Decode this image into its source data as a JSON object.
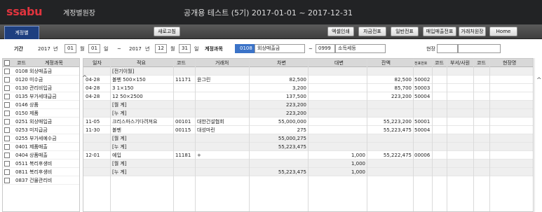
{
  "header": {
    "logo": "ssabu",
    "app_title": "계정별원장",
    "company": "공개용 테스트 (5기) 2017-01-01 ~ 2017-12-31"
  },
  "toolbar": {
    "tab": "계정별",
    "refresh": "새로고침",
    "buttons": [
      "엑셀인쇄",
      "자금전표",
      "일반전표",
      "매입매출전표",
      "거래처원장",
      "Home"
    ]
  },
  "filter": {
    "period_label": "기간",
    "start_year": "2017",
    "year_unit": "년",
    "start_month": "01",
    "month_unit": "월",
    "start_day": "01",
    "day_unit": "일",
    "tilde": "~",
    "end_year": "2017",
    "end_month": "12",
    "end_day": "31",
    "account_label": "계정과목",
    "from_code": "0108",
    "from_name": "외상매출금",
    "to_code": "0999",
    "to_name": "소득세등",
    "site_label": "현장",
    "site_code": "",
    "site_name": ""
  },
  "accounts": {
    "header": {
      "code": "코드",
      "name": "계정과목"
    },
    "items": [
      {
        "code": "0108",
        "name": "외상매출금"
      },
      {
        "code": "0120",
        "name": "미수금"
      },
      {
        "code": "0130",
        "name": "관리비입금"
      },
      {
        "code": "0135",
        "name": "부가세대급금"
      },
      {
        "code": "0146",
        "name": "상품"
      },
      {
        "code": "0150",
        "name": "제품"
      },
      {
        "code": "0251",
        "name": "외상매입금"
      },
      {
        "code": "0253",
        "name": "미지급금"
      },
      {
        "code": "0255",
        "name": "부가세예수금"
      },
      {
        "code": "0401",
        "name": "제품매출"
      },
      {
        "code": "0404",
        "name": "상품매출"
      },
      {
        "code": "0511",
        "name": "복리후생비"
      },
      {
        "code": "0811",
        "name": "복리후생비"
      },
      {
        "code": "0837",
        "name": "건물관리비"
      }
    ]
  },
  "ledger": {
    "columns": {
      "date": "일자",
      "desc": "적요",
      "code": "코드",
      "partner": "거래처",
      "debit": "차변",
      "credit": "대변",
      "balance": "잔액",
      "voucher": "전표번호",
      "code2": "코드",
      "dept": "부서/사원",
      "code3": "코드",
      "site": "현장명"
    },
    "rows": [
      {
        "date": "",
        "desc": "[전기이월]",
        "code": "",
        "partner": "",
        "debit": "",
        "credit": "",
        "balance": "",
        "voucher": "",
        "sub": true
      },
      {
        "date": "04-28",
        "desc": "볼펜 500×150",
        "code": "11171",
        "partner": "윤그린",
        "debit": "82,500",
        "credit": "",
        "balance": "82,500",
        "voucher": "50002",
        "sub": false
      },
      {
        "date": "04-28",
        "desc": "3 1×150",
        "code": "",
        "partner": "",
        "debit": "3,200",
        "credit": "",
        "balance": "85,700",
        "voucher": "50003",
        "sub": false
      },
      {
        "date": "04-28",
        "desc": "12 50×2500",
        "code": "",
        "partner": "",
        "debit": "137,500",
        "credit": "",
        "balance": "223,200",
        "voucher": "50004",
        "sub": false
      },
      {
        "date": "",
        "desc": "[월      계]",
        "code": "",
        "partner": "",
        "debit": "223,200",
        "credit": "",
        "balance": "",
        "voucher": "",
        "sub": true
      },
      {
        "date": "",
        "desc": "[누      계]",
        "code": "",
        "partner": "",
        "debit": "223,200",
        "credit": "",
        "balance": "",
        "voucher": "",
        "sub": true
      },
      {
        "date": "11-05",
        "desc": "크리스마스기다려져요",
        "code": "00101",
        "partner": "대한건설협회",
        "debit": "55,000,000",
        "credit": "",
        "balance": "55,223,200",
        "voucher": "50001",
        "sub": false
      },
      {
        "date": "11-30",
        "desc": "볼펜",
        "code": "00115",
        "partner": "대성마린",
        "debit": "275",
        "credit": "",
        "balance": "55,223,475",
        "voucher": "50004",
        "sub": false
      },
      {
        "date": "",
        "desc": "[월      계]",
        "code": "",
        "partner": "",
        "debit": "55,000,275",
        "credit": "",
        "balance": "",
        "voucher": "",
        "sub": true
      },
      {
        "date": "",
        "desc": "[누      계]",
        "code": "",
        "partner": "",
        "debit": "55,223,475",
        "credit": "",
        "balance": "",
        "voucher": "",
        "sub": true
      },
      {
        "date": "12-01",
        "desc": "예입",
        "code": "11181",
        "partner": "+",
        "debit": "",
        "credit": "1,000",
        "balance": "55,222,475",
        "voucher": "00006",
        "sub": false
      },
      {
        "date": "",
        "desc": "[월      계]",
        "code": "",
        "partner": "",
        "debit": "",
        "credit": "1,000",
        "balance": "",
        "voucher": "",
        "sub": true
      },
      {
        "date": "",
        "desc": "[누      계]",
        "code": "",
        "partner": "",
        "debit": "55,223,475",
        "credit": "1,000",
        "balance": "",
        "voucher": "",
        "sub": true
      }
    ]
  }
}
